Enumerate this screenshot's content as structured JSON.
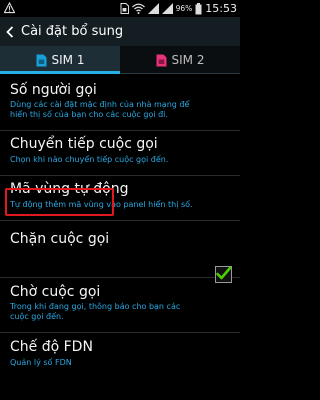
{
  "status_bar": {
    "battery_percent": "96%",
    "time": "15:53"
  },
  "header": {
    "title": "Cài đặt bổ sung"
  },
  "tabs": [
    {
      "label": "SIM 1",
      "active": true
    },
    {
      "label": "SIM 2",
      "active": false
    }
  ],
  "settings": [
    {
      "title": "Số người gọi",
      "subtitle_lines": [
        "Dùng các cài đặt mặc định của nhà mạng để",
        "hiển thị số của bạn cho các cuộc gọi đi."
      ]
    },
    {
      "title": "Chuyển tiếp cuộc gọi",
      "subtitle_lines": [
        "Chọn khi nào chuyển tiếp cuộc gọi đến."
      ]
    },
    {
      "title": "Mã vùng tự động",
      "subtitle_lines": [
        "Tự động thêm mã vùng vào panel hiển thị số."
      ]
    },
    {
      "title": "Chặn cuộc gọi",
      "subtitle_lines": []
    },
    {
      "title": "Chờ cuộc gọi",
      "subtitle_lines": [
        "Trong khi đang gọi, thông báo cho bạn các",
        "cuộc gọi đến."
      ],
      "checked": true
    },
    {
      "title": "Chế độ FDN",
      "subtitle_lines": [
        "Quản lý số FDN"
      ]
    }
  ],
  "colors": {
    "accent": "#28b0e6",
    "subtitle": "#2aa9e4",
    "highlight_border": "#e0191f",
    "check": "#4cd000",
    "sim1_icon": "#1aa0d8",
    "sim2_icon": "#e8327a"
  },
  "icons": {
    "status_left": "warning-icon",
    "status_right": [
      "sim-icon",
      "wifi-icon",
      "signal-icon",
      "signal-icon",
      "battery-icon"
    ],
    "back": "chevron-left-icon",
    "sim1": "sim-card-icon",
    "sim2": "sim-card-icon",
    "checkbox": "check-icon"
  }
}
